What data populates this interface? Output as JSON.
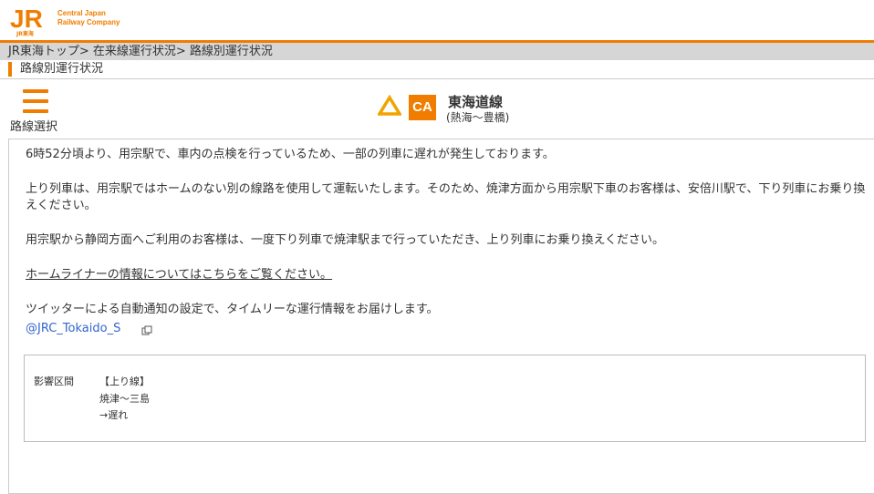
{
  "header": {
    "logo_text": "JR",
    "logo_sub": "JR東海",
    "company_line1": "Central Japan",
    "company_line2": "Railway Company",
    "brand_color": "#f07d00"
  },
  "breadcrumb": {
    "text": "JR東海トップ> 在来線運行状況> 路線別運行状況"
  },
  "page": {
    "title": "路線別運行状況"
  },
  "route_menu": {
    "label": "路線選択",
    "icon": "hamburger-menu-icon"
  },
  "line": {
    "status_icon": "warning-triangle-icon",
    "code": "CA",
    "name": "東海道線",
    "section": "(熱海～豊橋)"
  },
  "content": {
    "paragraph1": "6時52分頃より、用宗駅で、車内の点検を行っているため、一部の列車に遅れが発生しております。",
    "paragraph2": "上り列車は、用宗駅ではホームのない別の線路を使用して運転いたします。そのため、焼津方面から用宗駅下車のお客様は、安倍川駅で、下り列車にお乗り換えください。",
    "paragraph3": "用宗駅から静岡方面へご利用のお客様は、一度下り列車で焼津駅まで行っていただき、上り列車にお乗り換えください。",
    "home_liner_link": "ホームライナーの情報についてはこちらをご覧ください。",
    "twitter_note": "ツイッターによる自動通知の設定で、タイムリーな運行情報をお届けします。",
    "twitter_handle": "@JRC_Tokaido_S"
  },
  "affected": {
    "label": "影響区間",
    "direction": "【上り線】",
    "section": "焼津～三島",
    "status": "→遅れ"
  }
}
